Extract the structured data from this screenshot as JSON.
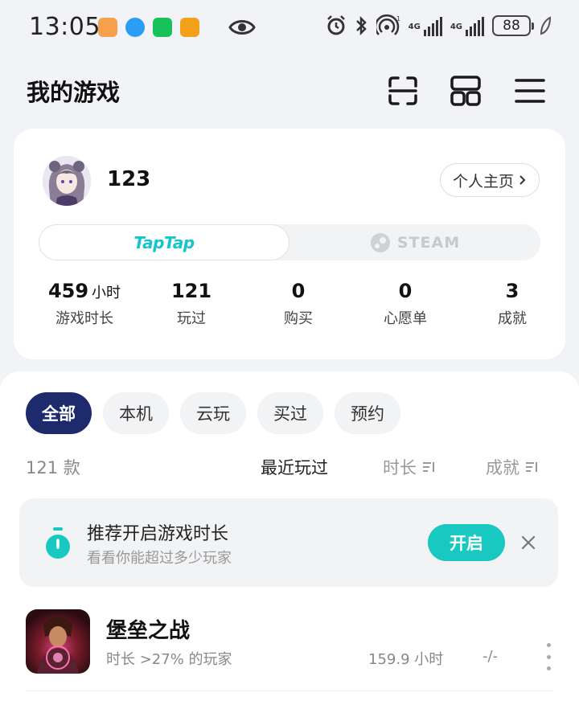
{
  "status_bar": {
    "time": "13:05",
    "network_1": "4G",
    "network_2": "4G",
    "battery": "88",
    "notification_icons": [
      "taobao-heart-icon",
      "message-bubble-icon",
      "wechat-icon",
      "note-app-icon"
    ]
  },
  "header": {
    "title": "我的游戏",
    "icons": [
      "scan-icon",
      "grid-icon",
      "menu-icon"
    ]
  },
  "profile": {
    "username": "123",
    "homepage_label": "个人主页",
    "platform_tabs": [
      {
        "label": "TapTap",
        "active": true
      },
      {
        "label": "STEAM",
        "active": false
      }
    ],
    "stats": [
      {
        "value": "459",
        "unit": "小时",
        "label": "游戏时长"
      },
      {
        "value": "121",
        "unit": "",
        "label": "玩过"
      },
      {
        "value": "0",
        "unit": "",
        "label": "购买"
      },
      {
        "value": "0",
        "unit": "",
        "label": "心愿单"
      },
      {
        "value": "3",
        "unit": "",
        "label": "成就"
      }
    ]
  },
  "library": {
    "filters": [
      {
        "label": "全部",
        "active": true
      },
      {
        "label": "本机",
        "active": false
      },
      {
        "label": "云玩",
        "active": false
      },
      {
        "label": "买过",
        "active": false
      },
      {
        "label": "预约",
        "active": false
      }
    ],
    "count": "121 款",
    "sort_options": {
      "recent": "最近玩过",
      "duration": "时长",
      "achievement": "成就"
    },
    "banner": {
      "title": "推荐开启游戏时长",
      "subtitle": "看看你能超过多少玩家",
      "button": "开启"
    },
    "games": [
      {
        "name": "堡垒之战",
        "subtitle": "时长 >27% 的玩家",
        "playtime": "159.9 小时",
        "achievements": "-/-"
      }
    ]
  },
  "colors": {
    "accent_teal": "#19c8c1",
    "filter_active": "#1d2b6d",
    "taptap_brand": "#15c5ce"
  }
}
